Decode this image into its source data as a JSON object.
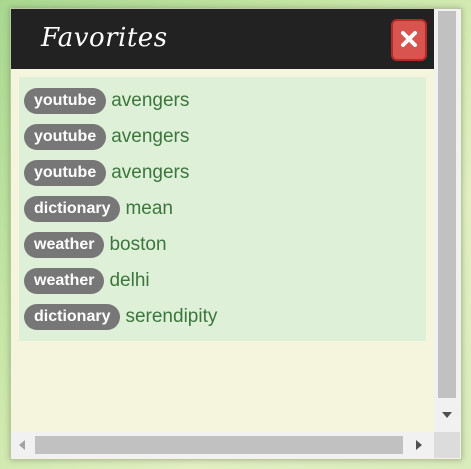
{
  "window": {
    "title": "Favorites",
    "close_icon": "close-icon"
  },
  "favorites": [
    {
      "tag": "youtube",
      "query": "avengers"
    },
    {
      "tag": "youtube",
      "query": "avengers"
    },
    {
      "tag": "youtube",
      "query": "avengers"
    },
    {
      "tag": "dictionary",
      "query": "mean"
    },
    {
      "tag": "weather",
      "query": "boston"
    },
    {
      "tag": "weather",
      "query": "delhi"
    },
    {
      "tag": "dictionary",
      "query": "serendipity"
    }
  ],
  "colors": {
    "titlebar": "#222222",
    "close_button": "#d9534f",
    "list_background": "#dff0d8",
    "tag_background": "#777777",
    "query_text": "#3c763d",
    "window_background": "#f5f5de"
  }
}
